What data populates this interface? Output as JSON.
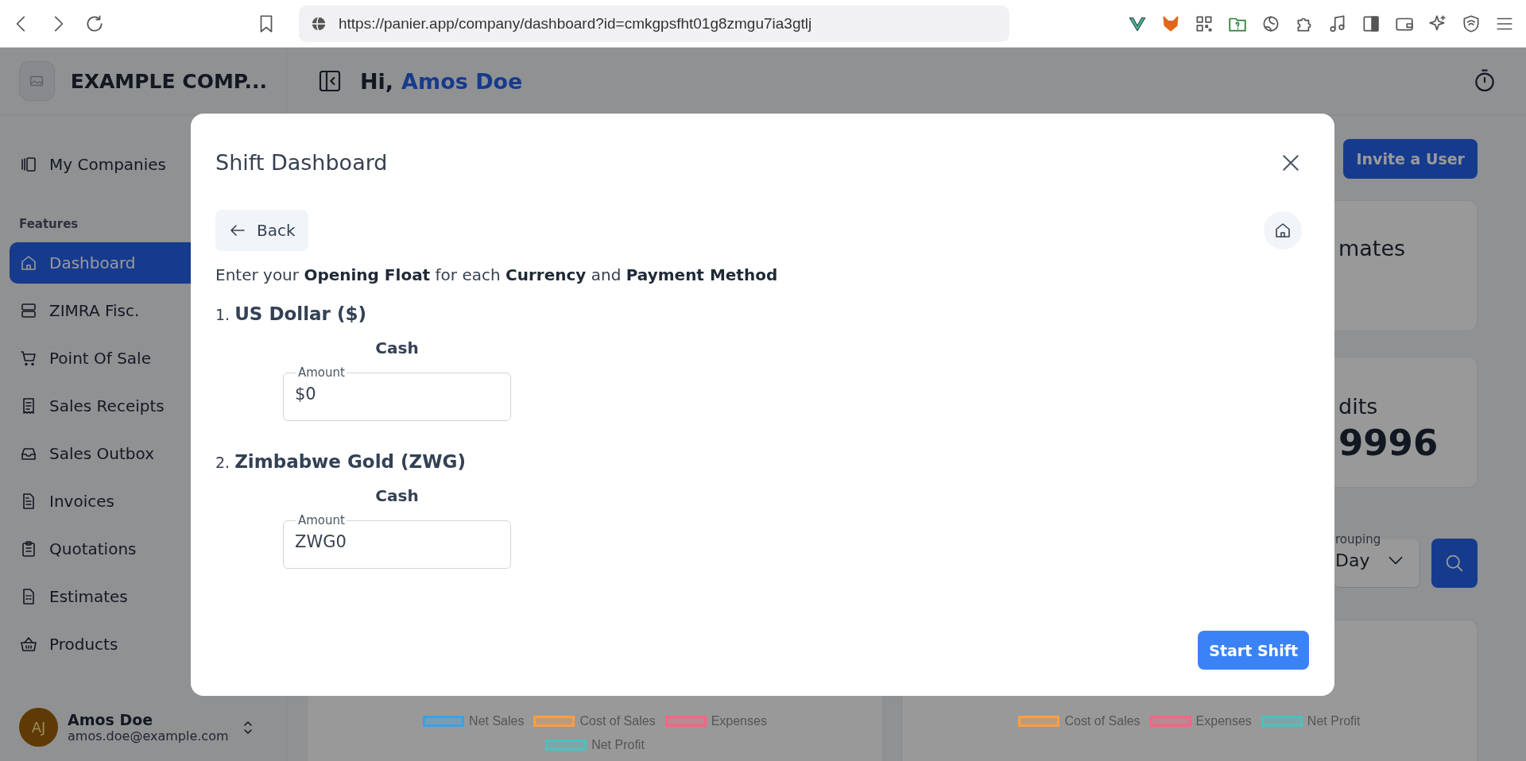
{
  "browser": {
    "url": "https://panier.app/company/dashboard?id=cmkgpsfht01g8zmgu7ia3gtlj"
  },
  "sidebar": {
    "company": "EXAMPLE COMP...",
    "top_item": "My Companies",
    "section": "Features",
    "items": [
      {
        "label": "Dashboard",
        "selected": true
      },
      {
        "label": "ZIMRA Fisc.",
        "selected": false
      },
      {
        "label": "Point Of Sale",
        "selected": false
      },
      {
        "label": "Sales Receipts",
        "selected": false
      },
      {
        "label": "Sales Outbox",
        "selected": false
      },
      {
        "label": "Invoices",
        "selected": false
      },
      {
        "label": "Quotations",
        "selected": false
      },
      {
        "label": "Estimates",
        "selected": false
      },
      {
        "label": "Products",
        "selected": false
      }
    ],
    "user": {
      "initials": "AJ",
      "name": "Amos Doe",
      "email": "amos.doe@example.com"
    }
  },
  "header": {
    "greeting": "Hi,",
    "name": "Amos Doe"
  },
  "dashboard": {
    "invite_button": "Invite a User",
    "cards": [
      {
        "title": "mates"
      },
      {
        "title": "dits",
        "value": "9996"
      }
    ],
    "grouping": {
      "label": "rouping",
      "value": "Day"
    },
    "legends": [
      [
        {
          "label": "Net Sales",
          "color": "#36a2eb"
        },
        {
          "label": "Cost of Sales",
          "color": "#ff9f40"
        },
        {
          "label": "Expenses",
          "color": "#ff6384"
        },
        {
          "label": "Net Profit",
          "color": "#4bc0c0"
        }
      ],
      [
        {
          "label": "Cost of Sales",
          "color": "#ff9f40"
        },
        {
          "label": "Expenses",
          "color": "#ff6384"
        },
        {
          "label": "Net Profit",
          "color": "#4bc0c0"
        }
      ]
    ]
  },
  "modal": {
    "title": "Shift Dashboard",
    "back_button": "Back",
    "instruction": "Enter your **Opening Float** for each **Currency** and **Payment Method**",
    "currencies": [
      {
        "number": "1.",
        "name": "US Dollar ($)",
        "methods": [
          {
            "label": "Cash",
            "field_label": "Amount",
            "value": "$0"
          }
        ]
      },
      {
        "number": "2.",
        "name": "Zimbabwe Gold (ZWG)",
        "methods": [
          {
            "label": "Cash",
            "field_label": "Amount",
            "value": "ZWG0"
          }
        ]
      }
    ],
    "start_button": "Start Shift"
  }
}
